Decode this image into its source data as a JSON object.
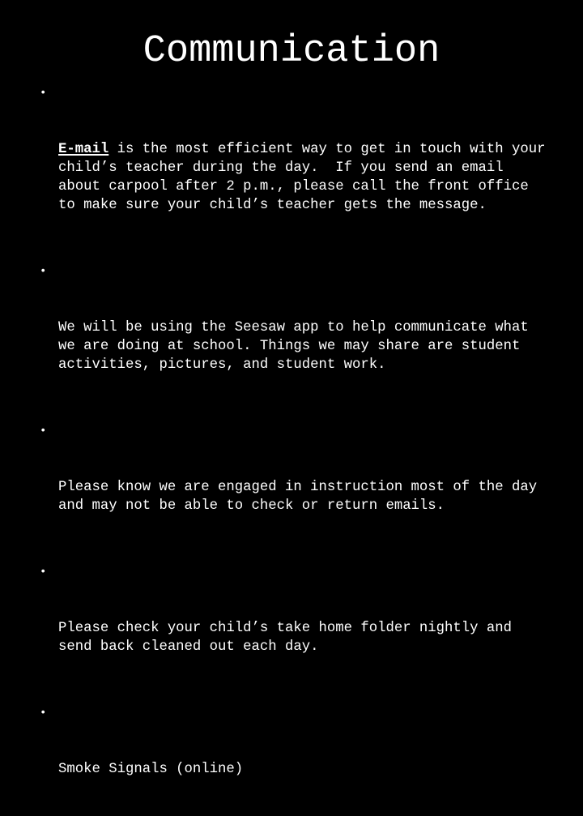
{
  "slide": {
    "title": "Communication",
    "background_color": "#000000",
    "text_color": "#ffffff",
    "bullet_marker": "•",
    "bullets": [
      {
        "emphasis": "E-mail",
        "emphasis_style": "bold-underline",
        "rest": " is the most efficient way to get in touch with your child’s teacher during the day.  If you send an email about carpool after 2 p.m., please call the front office to make sure your child’s teacher gets the message.",
        "full_text": "E-mail is the most efficient way to get in touch with your child’s teacher during the day.  If you send an email about carpool after 2 p.m., please call the front office to make sure your child’s teacher gets the message."
      },
      {
        "emphasis": "",
        "rest": "We will be using the Seesaw app to help communicate what we are doing at school. Things we may share are student activities, pictures, and student work.",
        "full_text": "We will be using the Seesaw app to help communicate what we are doing at school. Things we may share are student activities, pictures, and student work."
      },
      {
        "emphasis": "",
        "rest": "Please know we are engaged in instruction most of the day and may not be able to check or return emails.",
        "full_text": "Please know we are engaged in instruction most of the day and may not be able to check or return emails."
      },
      {
        "emphasis": "",
        "rest": "Please check your child’s take home folder nightly and send back cleaned out each day.",
        "full_text": "Please check your child’s take home folder nightly and send back cleaned out each day."
      },
      {
        "emphasis": "",
        "rest": "Smoke Signals (online)",
        "full_text": "Smoke Signals (online)"
      }
    ]
  }
}
